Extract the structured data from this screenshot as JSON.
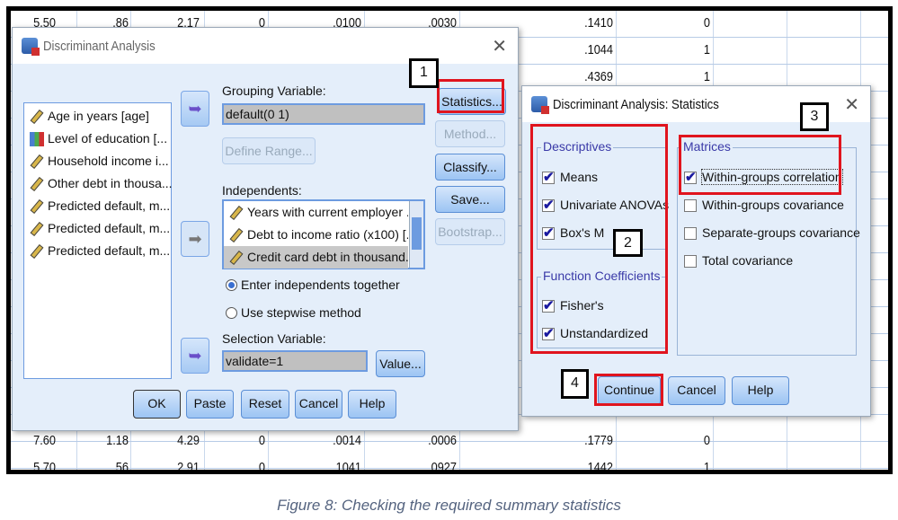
{
  "spreadsheet": {
    "top_rows": [
      [
        "5.50",
        ".86",
        "2.17",
        "0",
        ".0100",
        ".0030",
        ".1410",
        "0"
      ],
      [
        "",
        "",
        "",
        "",
        "",
        "",
        ".1044",
        "1"
      ],
      [
        "",
        "",
        "",
        "",
        "",
        "",
        ".4369",
        "1"
      ]
    ],
    "bottom_rows": [
      [
        "7.60",
        "1.18",
        "4.29",
        "0",
        ".0014",
        ".0006",
        ".1779",
        "0"
      ],
      [
        "5.70",
        ".56",
        "2.91",
        "0",
        ".1041",
        ".0927",
        ".1442",
        "1"
      ]
    ]
  },
  "main_dialog": {
    "title": "Discriminant Analysis",
    "variables": [
      {
        "label": "Age in years [age]",
        "icon": "scale-icon"
      },
      {
        "label": "Level of education [...",
        "icon": "ordinal-icon"
      },
      {
        "label": "Household income i...",
        "icon": "scale-icon"
      },
      {
        "label": "Other debt in thousa...",
        "icon": "scale-icon"
      },
      {
        "label": "Predicted default, m...",
        "icon": "scale-icon"
      },
      {
        "label": "Predicted default, m...",
        "icon": "scale-icon"
      },
      {
        "label": "Predicted default, m...",
        "icon": "scale-icon"
      }
    ],
    "grouping_label": "Grouping Variable:",
    "grouping_value": "default(0 1)",
    "define_range": "Define Range...",
    "independents_label": "Independents:",
    "independents": [
      "Years with current employer ...",
      "Debt to income ratio (x100) [...",
      "Credit card debt in thousand..."
    ],
    "radio_together": "Enter independents together",
    "radio_stepwise": "Use stepwise method",
    "selected_method": "together",
    "selection_label": "Selection Variable:",
    "selection_value": "validate=1",
    "value_button": "Value...",
    "side_buttons": {
      "statistics": "Statistics...",
      "method": "Method...",
      "classify": "Classify...",
      "save": "Save...",
      "bootstrap": "Bootstrap..."
    },
    "bottom_buttons": {
      "ok": "OK",
      "paste": "Paste",
      "reset": "Reset",
      "cancel": "Cancel",
      "help": "Help"
    }
  },
  "stats_dialog": {
    "title": "Discriminant Analysis: Statistics",
    "descriptives": {
      "label": "Descriptives",
      "items": [
        {
          "label": "Means",
          "checked": true
        },
        {
          "label": "Univariate ANOVAs",
          "checked": true
        },
        {
          "label": "Box's M",
          "checked": true
        }
      ]
    },
    "function_coefficients": {
      "label": "Function Coefficients",
      "items": [
        {
          "label": "Fisher's",
          "checked": true
        },
        {
          "label": "Unstandardized",
          "checked": true
        }
      ]
    },
    "matrices": {
      "label": "Matrices",
      "items": [
        {
          "label": "Within-groups correlation",
          "checked": true
        },
        {
          "label": "Within-groups covariance",
          "checked": false
        },
        {
          "label": "Separate-groups covariance",
          "checked": false
        },
        {
          "label": "Total covariance",
          "checked": false
        }
      ]
    },
    "buttons": {
      "continue": "Continue",
      "cancel": "Cancel",
      "help": "Help"
    }
  },
  "annotations": [
    "1",
    "2",
    "3",
    "4"
  ],
  "highlight_color": "#e0141e",
  "caption": "Figure 8: Checking the required summary statistics"
}
